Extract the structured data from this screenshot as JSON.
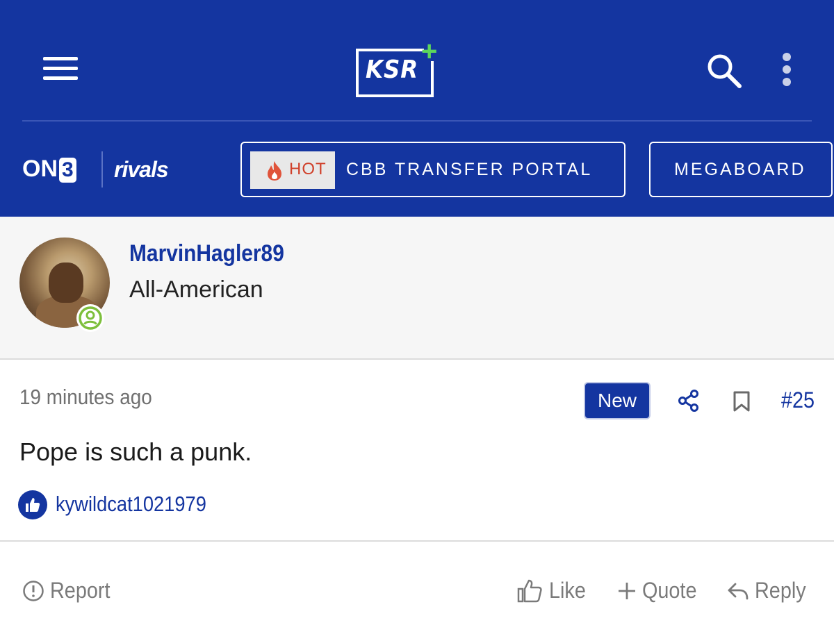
{
  "header": {
    "logo_text": "KSR",
    "logo_plus": "+",
    "brand_on3_prefix": "ON",
    "brand_on3_suffix": "3",
    "brand_rivals": "rivals",
    "nav": [
      {
        "badge": "HOT",
        "label": "CBB TRANSFER PORTAL"
      },
      {
        "label": "MEGABOARD"
      }
    ]
  },
  "user": {
    "username": "MarvinHagler89",
    "title": "All-American"
  },
  "post": {
    "timestamp": "19 minutes ago",
    "new_badge": "New",
    "number": "#25",
    "body": "Pope is such a punk.",
    "likers": "kywildcat1021979"
  },
  "actions": {
    "report": "Report",
    "like": "Like",
    "quote": "Quote",
    "reply": "Reply"
  },
  "colors": {
    "brand_blue": "#1435a0",
    "hot_red": "#d0402a",
    "online_green": "#7dbf3c"
  },
  "icons": [
    "menu-icon",
    "search-icon",
    "more-vertical-icon",
    "flame-icon",
    "online-status-icon",
    "share-icon",
    "bookmark-icon",
    "thumbs-up-icon",
    "alert-circle-icon",
    "plus-icon",
    "reply-icon"
  ]
}
